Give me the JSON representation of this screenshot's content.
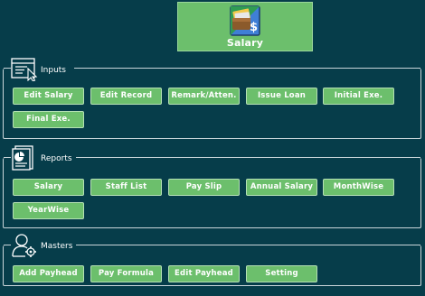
{
  "header": {
    "title": "Salary",
    "icon": "salary-wallet-icon"
  },
  "groups": {
    "inputs": {
      "title": "Inputs",
      "icon": "form-cursor-icon",
      "buttons": [
        "Edit Salary",
        "Edit Record",
        "Remark/Atten.",
        "Issue Loan",
        "Initial Exe.",
        "Final Exe."
      ]
    },
    "reports": {
      "title": "Reports",
      "icon": "report-chart-icon",
      "buttons": [
        "Salary",
        "Staff List",
        "Pay Slip",
        "Annual Salary",
        "MonthWise",
        "YearWise"
      ]
    },
    "masters": {
      "title": "Masters",
      "icon": "user-settings-icon",
      "buttons": [
        "Add Payhead",
        "Pay Formula",
        "Edit Payhead",
        "Setting"
      ]
    }
  },
  "colors": {
    "background": "#063d4a",
    "button": "#6cbf6c",
    "button_border": "#b5e0b5",
    "group_border": "#c9d6da"
  }
}
